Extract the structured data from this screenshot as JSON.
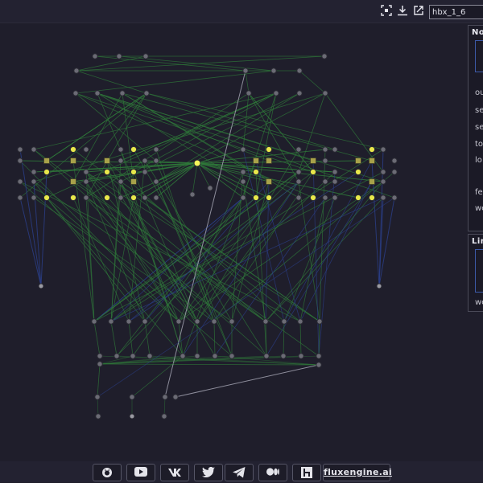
{
  "toolbar": {
    "network_name": "hbx_1_6",
    "icons": [
      "fit-view-icon",
      "download-icon",
      "open-external-icon"
    ]
  },
  "node_panel": {
    "title": "No",
    "rows": [
      "ou",
      "se",
      "se",
      "to",
      "lo",
      "fe",
      "we"
    ]
  },
  "link_panel": {
    "title": "Lin",
    "rows": [
      "we"
    ]
  },
  "footer": {
    "buttons": [
      "github-icon",
      "youtube-icon",
      "vk-icon",
      "twitter-icon",
      "telegram-icon",
      "medium-icon",
      "habr-icon"
    ],
    "brand_label": "fluxengine.ai"
  },
  "colors": {
    "background": "#1f1e2b",
    "node": "#6b6b75",
    "active_node": "#e8e84a",
    "link_green": "#2f7a3a",
    "link_blue": "#2b3f8a",
    "link_gray": "#9a9aa8"
  }
}
